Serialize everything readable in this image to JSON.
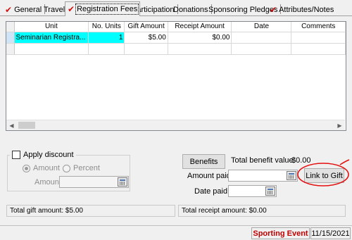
{
  "tabs": [
    {
      "label": "General",
      "checked": true
    },
    {
      "label": "Travel",
      "checked": false
    },
    {
      "label": "Registration Fees",
      "checked": true,
      "active": true
    },
    {
      "label": "Participation",
      "checked": false
    },
    {
      "label": "Donations",
      "checked": false
    },
    {
      "label": "Sponsoring Pledges",
      "checked": false
    },
    {
      "label": "Attributes/Notes",
      "checked": true
    }
  ],
  "grid": {
    "columns": [
      "Unit",
      "No. Units",
      "Gift Amount",
      "Receipt Amount",
      "Date",
      "Comments"
    ],
    "rows": [
      {
        "unit": "Seminarian Registra...",
        "units": "1",
        "gift": "$5.00",
        "receipt": "$0.00",
        "date": "",
        "comments": ""
      }
    ]
  },
  "discount": {
    "apply_label": "Apply discount",
    "amount_radio": "Amount",
    "percent_radio": "Percent",
    "amount_label": "Amount:",
    "amount_value": ""
  },
  "benefits": {
    "button_label": "Benefits",
    "total_label": "Total benefit value:",
    "total_value": "$0.00"
  },
  "payment": {
    "amount_paid_label": "Amount paid:",
    "amount_paid_value": "",
    "link_button": "Link to Gift",
    "date_paid_label": "Date paid:",
    "date_paid_value": ""
  },
  "totals": {
    "gift": "Total gift amount: $5.00",
    "receipt": "Total receipt amount: $0.00"
  },
  "status": {
    "event": "Sporting Event",
    "date": "11/15/2021"
  },
  "colors": {
    "check_mark": "#d01010",
    "selected_cell": "#00ffff",
    "status_event": "#c00000",
    "annotation": "#e41010"
  }
}
